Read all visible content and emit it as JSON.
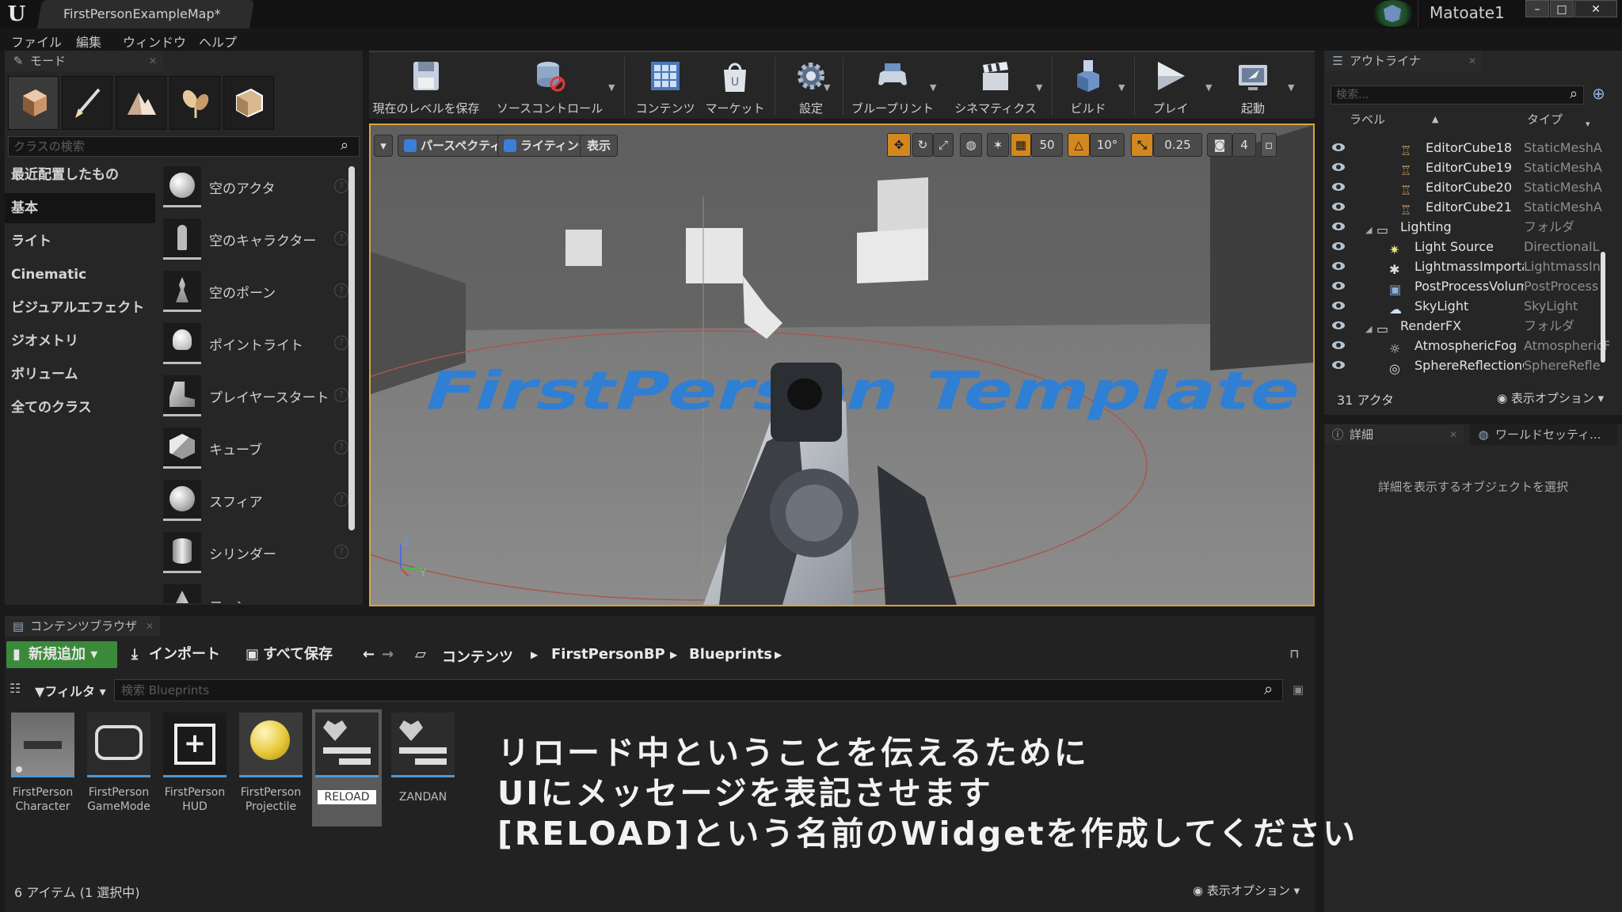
{
  "titlebar": {
    "tab_title": "FirstPersonExampleMap*",
    "user": "Matoate1"
  },
  "menu": [
    "ファイル",
    "編集",
    "ウィンドウ",
    "ヘルプ"
  ],
  "modes": {
    "tab": "モード",
    "search_placeholder": "クラスの検索",
    "categories": [
      "最近配置したもの",
      "基本",
      "ライト",
      "Cinematic",
      "ビジュアルエフェクト",
      "ジオメトリ",
      "ボリューム",
      "全てのクラス"
    ],
    "placeables": [
      "空のアクタ",
      "空のキャラクター",
      "空のポーン",
      "ポイントライト",
      "プレイヤースタート",
      "キューブ",
      "スフィア",
      "シリンダー",
      "コーン"
    ]
  },
  "toolbar": [
    "現在のレベルを保存",
    "ソースコントロール",
    "コンテンツ",
    "マーケット",
    "設定",
    "ブループリント",
    "シネマティクス",
    "ビルド",
    "プレイ",
    "起動"
  ],
  "viewport": {
    "perspective": "パースペクティブ",
    "lighting": "ライティング",
    "show": "表示",
    "grid_snap": "50",
    "rotate_snap": "10°",
    "scale_snap": "0.25",
    "camera_speed": "4",
    "floor_text": "FirstPerson Template",
    "axis_z": "Z",
    "axis_y": "Y",
    "colors": {
      "border": "#d7a43a",
      "floor_text": "#2f7fd4"
    }
  },
  "outliner": {
    "tab": "アウトライナ",
    "search_placeholder": "検索...",
    "col_label": "ラベル",
    "col_type": "タイプ",
    "rows": [
      {
        "name": "EditorCube18",
        "type": "StaticMeshA"
      },
      {
        "name": "EditorCube19",
        "type": "StaticMeshA"
      },
      {
        "name": "EditorCube20",
        "type": "StaticMeshA"
      },
      {
        "name": "EditorCube21",
        "type": "StaticMeshA"
      },
      {
        "name": "Lighting",
        "type": "フォルダ"
      },
      {
        "name": "Light Source",
        "type": "DirectionalL"
      },
      {
        "name": "LightmassImportal",
        "type": "LightmassIn"
      },
      {
        "name": "PostProcessVolum",
        "type": "PostProcess"
      },
      {
        "name": "SkyLight",
        "type": "SkyLight"
      },
      {
        "name": "RenderFX",
        "type": "フォルダ"
      },
      {
        "name": "AtmosphericFog",
        "type": "AtmosphericF"
      },
      {
        "name": "SphereReflectionC",
        "type": "SphereRefle"
      }
    ],
    "actor_count": "31 アクタ",
    "view_options": "表示オプション"
  },
  "details": {
    "tab_details": "詳細",
    "tab_world": "ワールドセッティ...",
    "empty_message": "詳細を表示するオブジェクトを選択"
  },
  "content_browser": {
    "tab": "コンテンツブラウザ",
    "add_new": "新規追加",
    "import": "インポート",
    "save_all": "すべて保存",
    "path": [
      "コンテンツ",
      "FirstPersonBP",
      "Blueprints"
    ],
    "filter": "フィルタ",
    "search_placeholder": "検索 Blueprints",
    "assets": [
      {
        "line1": "FirstPerson",
        "line2": "Character"
      },
      {
        "line1": "FirstPerson",
        "line2": "GameMode"
      },
      {
        "line1": "FirstPerson",
        "line2": "HUD"
      },
      {
        "line1": "FirstPerson",
        "line2": "Projectile"
      },
      {
        "line1": "RELOAD",
        "line2": ""
      },
      {
        "line1": "ZANDAN",
        "line2": ""
      }
    ],
    "item_count": "6 アイテム (1 選択中)",
    "view_options": "表示オプション"
  },
  "caption": {
    "line1": "リロード中ということを伝えるために",
    "line2": "UIにメッセージを表記させます",
    "line3": "[RELOAD]という名前のWidgetを作成してください"
  }
}
